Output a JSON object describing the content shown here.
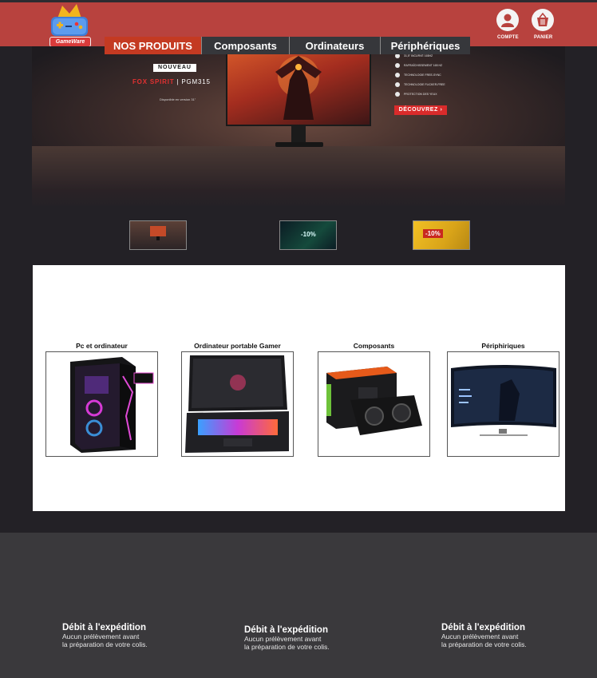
{
  "header": {
    "logo_text": "GameWare",
    "account_label": "COMPTE",
    "cart_label": "PANIER",
    "account_icon": "user-icon",
    "cart_icon": "basket-icon"
  },
  "nav": {
    "tabs": [
      {
        "label": "NOS PRODUITS"
      },
      {
        "label": "Composants"
      },
      {
        "label": "Ordinateurs"
      },
      {
        "label": "Périphériques"
      }
    ]
  },
  "hero": {
    "badge": "NOUVEAU",
    "brand": "FOX SPIRIT",
    "model": "PGM315",
    "availability": "Disponible en version 31\"",
    "features": [
      "31,5\" INCURVÉ 165HZ",
      "RAFRAÎCHISSEMENT 165 HZ",
      "TECHNOLOGIE FREE-SYNC",
      "TECHNOLOGIE FLICKER-FREE",
      "PROTECTION DES YEUX"
    ],
    "cta": "DÉCOUVREZ ›"
  },
  "thumbnails": [
    {
      "label": ""
    },
    {
      "label": "-10%"
    },
    {
      "label": "-10%"
    }
  ],
  "categories": [
    {
      "title": "Pc et ordinateur"
    },
    {
      "title": "Ordinateur portable Gamer"
    },
    {
      "title": "Composants"
    },
    {
      "title": "Périphiriques"
    }
  ],
  "footer": {
    "items": [
      {
        "title": "Débit à l'expédition",
        "line1": "Aucun prélèvement avant",
        "line2": "la préparation de votre colis."
      },
      {
        "title": "Débit à l'expédition",
        "line1": "Aucun prélèvement avant",
        "line2": "la préparation de votre colis."
      },
      {
        "title": "Débit à l'expédition",
        "line1": "Aucun prélèvement avant",
        "line2": "la préparation de votre colis."
      }
    ]
  },
  "colors": {
    "header_red": "#b8423e",
    "tab_active": "#c43a22",
    "tab_dark": "#36373b",
    "page_bg": "#232126",
    "footer_bg": "#3a393c",
    "cta_red": "#d92b2b"
  }
}
